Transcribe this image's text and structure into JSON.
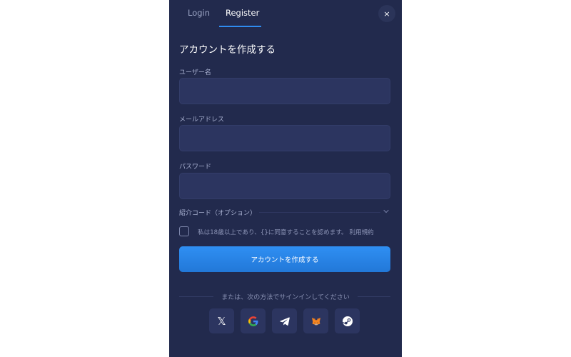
{
  "tabs": {
    "login": "Login",
    "register": "Register"
  },
  "close": "×",
  "title": "アカウントを作成する",
  "fields": {
    "username": {
      "label": "ユーザー名",
      "value": "",
      "placeholder": ""
    },
    "email": {
      "label": "メールアドレス",
      "value": "",
      "placeholder": ""
    },
    "password": {
      "label": "パスワード",
      "value": "",
      "placeholder": ""
    }
  },
  "referral": {
    "label": "紹介コード（オプション）"
  },
  "agreement": {
    "text": "私は18歳以上であり、{}に同意することを認めます。 利用規約",
    "checked": false
  },
  "submit": "アカウントを作成する",
  "divider": "または、次の方法でサインインしてください",
  "social": [
    {
      "name": "x-icon",
      "glyph": "𝕏"
    },
    {
      "name": "google-icon",
      "glyph": "G"
    },
    {
      "name": "telegram-icon",
      "glyph": ""
    },
    {
      "name": "metamask-icon",
      "glyph": ""
    },
    {
      "name": "steam-icon",
      "glyph": ""
    }
  ],
  "colors": {
    "panel": "#222a4d",
    "input": "#2c3560",
    "accent": "#2f8cf0"
  }
}
